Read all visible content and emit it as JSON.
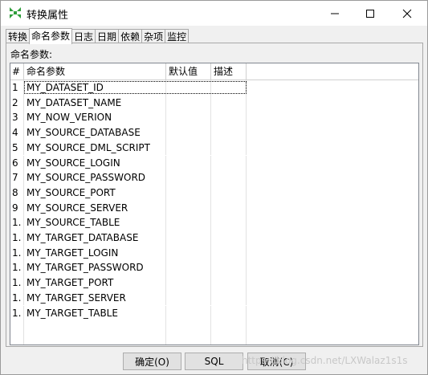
{
  "window": {
    "title": "转换属性"
  },
  "tabs": [
    "转换",
    "命名参数",
    "日志",
    "日期",
    "依赖",
    "杂项",
    "监控"
  ],
  "section_label": "命名参数:",
  "columns": [
    "#",
    "命名参数",
    "默认值",
    "描述"
  ],
  "rows": [
    {
      "num": "1",
      "name": "MY_DATASET_ID"
    },
    {
      "num": "2",
      "name": "MY_DATASET_NAME"
    },
    {
      "num": "3",
      "name": "MY_NOW_VERION"
    },
    {
      "num": "4",
      "name": "MY_SOURCE_DATABASE"
    },
    {
      "num": "5",
      "name": "MY_SOURCE_DML_SCRIPT"
    },
    {
      "num": "6",
      "name": "MY_SOURCE_LOGIN"
    },
    {
      "num": "7",
      "name": "MY_SOURCE_PASSWORD"
    },
    {
      "num": "8",
      "name": "MY_SOURCE_PORT"
    },
    {
      "num": "9",
      "name": "MY_SOURCE_SERVER"
    },
    {
      "num": "1.",
      "name": "MY_SOURCE_TABLE"
    },
    {
      "num": "1.",
      "name": "MY_TARGET_DATABASE"
    },
    {
      "num": "1.",
      "name": "MY_TARGET_LOGIN"
    },
    {
      "num": "1.",
      "name": "MY_TARGET_PASSWORD"
    },
    {
      "num": "1.",
      "name": "MY_TARGET_PORT"
    },
    {
      "num": "1.",
      "name": "MY_TARGET_SERVER"
    },
    {
      "num": "1.",
      "name": "MY_TARGET_TABLE"
    }
  ],
  "buttons": {
    "ok": "确定(O)",
    "sql": "SQL",
    "cancel": "取消(C)"
  },
  "watermark": "https://blog.csdn.net/LXWalaz1s1s",
  "colors": {
    "icon_green": "#2e9d3a",
    "titlebar": "#ffffff",
    "dialog_bg": "#f0f0f0"
  }
}
